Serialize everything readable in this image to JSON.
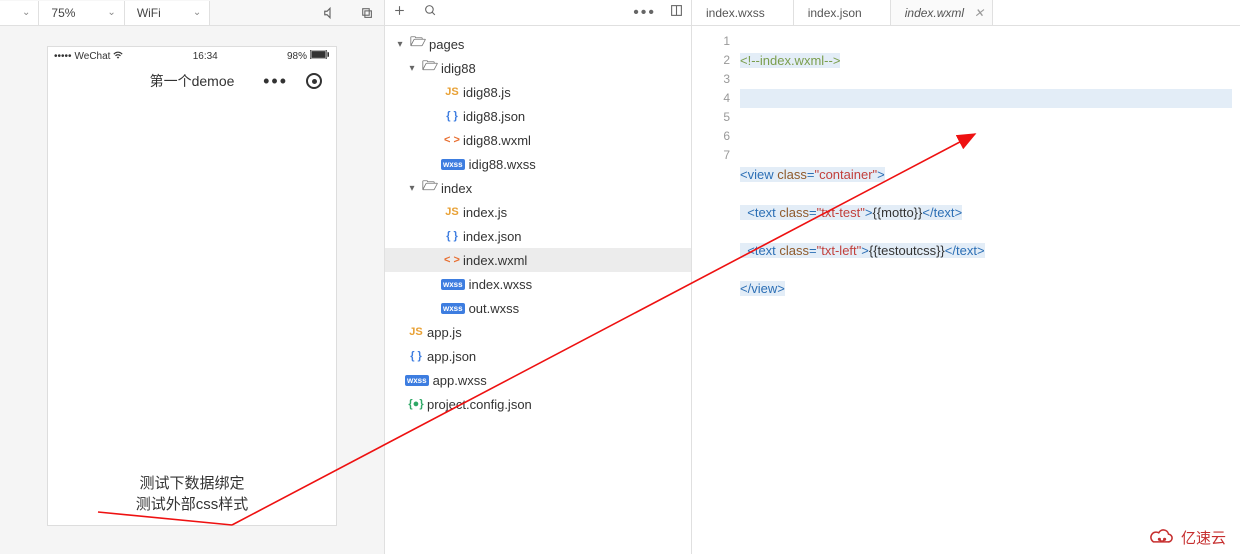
{
  "toolbar": {
    "zoom_level": "75%",
    "network": "WiFi"
  },
  "simulator": {
    "carrier_dots": "•••••",
    "carrier_name": "WeChat",
    "time": "16:34",
    "battery_pct": "98%",
    "page_title": "第一个demoe",
    "text1": "测试下数据绑定",
    "text2": "测试外部css样式"
  },
  "tree": {
    "root": "pages",
    "folders": [
      {
        "name": "idig88",
        "files": [
          {
            "name": "idig88.js",
            "type": "js"
          },
          {
            "name": "idig88.json",
            "type": "json"
          },
          {
            "name": "idig88.wxml",
            "type": "wxml"
          },
          {
            "name": "idig88.wxss",
            "type": "wxss"
          }
        ]
      },
      {
        "name": "index",
        "files": [
          {
            "name": "index.js",
            "type": "js"
          },
          {
            "name": "index.json",
            "type": "json"
          },
          {
            "name": "index.wxml",
            "type": "wxml",
            "selected": true
          },
          {
            "name": "index.wxss",
            "type": "wxss"
          },
          {
            "name": "out.wxss",
            "type": "wxss"
          }
        ]
      }
    ],
    "rootfiles": [
      {
        "name": "app.js",
        "type": "js"
      },
      {
        "name": "app.json",
        "type": "json"
      },
      {
        "name": "app.wxss",
        "type": "wxss"
      },
      {
        "name": "project.config.json",
        "type": "config"
      }
    ]
  },
  "tabs": [
    {
      "label": "index.wxss"
    },
    {
      "label": "index.json"
    },
    {
      "label": "index.wxml",
      "active": true
    }
  ],
  "code": {
    "lines": [
      "1",
      "2",
      "3",
      "4",
      "5",
      "6",
      "7"
    ],
    "comment": "<!--index.wxml-->",
    "view_open_tag": "view",
    "view_attr_class": "class",
    "view_class_val": "\"container\"",
    "text_tag": "text",
    "text1_class_val": "\"txt-test\"",
    "text1_content": "{{motto}}",
    "text2_class_val": "\"txt-left\"",
    "text2_content": "{{testoutcss}}",
    "close_text": "</text>",
    "close_view": "</view>"
  },
  "logo_text": "亿速云"
}
